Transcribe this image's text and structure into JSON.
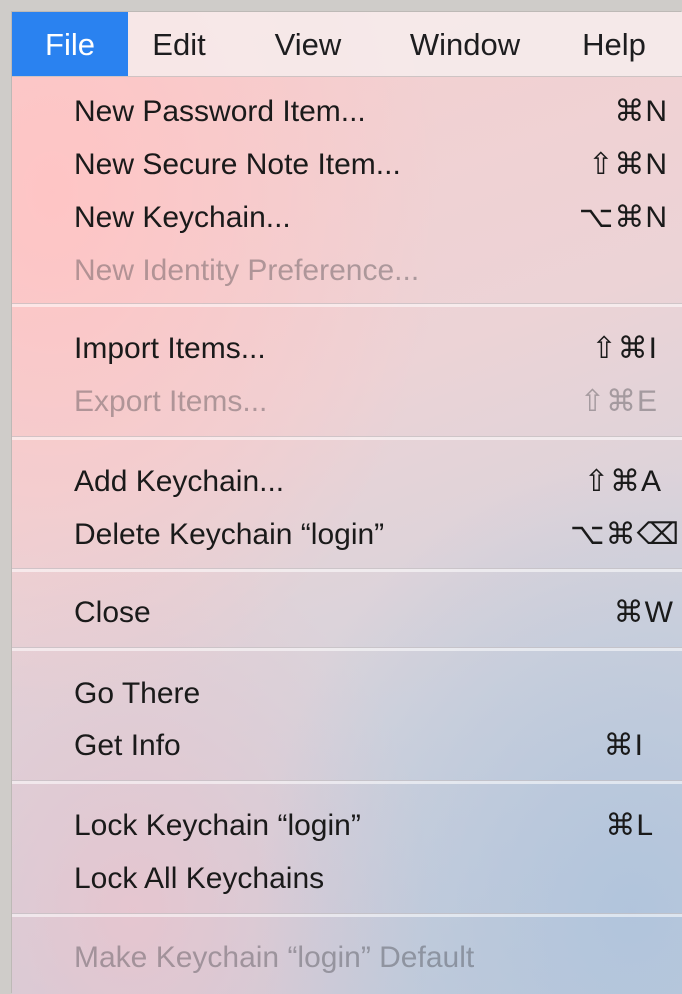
{
  "menubar": {
    "items": [
      {
        "label": "File"
      },
      {
        "label": "Edit"
      },
      {
        "label": "View"
      },
      {
        "label": "Window"
      },
      {
        "label": "Help"
      }
    ],
    "active": "File",
    "active_color": "#2a82f0"
  },
  "menu": {
    "items": [
      {
        "label": "New Password Item...",
        "shortcut": "⌘N",
        "enabled": true
      },
      {
        "label": "New Secure Note Item...",
        "shortcut": "⇧⌘N",
        "enabled": true
      },
      {
        "label": "New Keychain...",
        "shortcut": "⌥⌘N",
        "enabled": true
      },
      {
        "label": "New Identity Preference...",
        "shortcut": "",
        "enabled": false
      },
      {
        "label": "Import Items...",
        "shortcut": "⇧⌘I",
        "enabled": true
      },
      {
        "label": "Export Items...",
        "shortcut": "⇧⌘E",
        "enabled": false
      },
      {
        "label": "Add Keychain...",
        "shortcut": "⇧⌘A",
        "enabled": true
      },
      {
        "label": "Delete Keychain “login”",
        "shortcut": "⌥⌘⌫",
        "enabled": true
      },
      {
        "label": "Close",
        "shortcut": "⌘W",
        "enabled": true
      },
      {
        "label": "Go There",
        "shortcut": "",
        "enabled": true
      },
      {
        "label": "Get Info",
        "shortcut": "⌘I",
        "enabled": true
      },
      {
        "label": "Lock Keychain “login”",
        "shortcut": "⌘L",
        "enabled": true
      },
      {
        "label": "Lock All Keychains",
        "shortcut": "",
        "enabled": true
      },
      {
        "label": "Make Keychain “login” Default",
        "shortcut": "",
        "enabled": false
      }
    ]
  }
}
